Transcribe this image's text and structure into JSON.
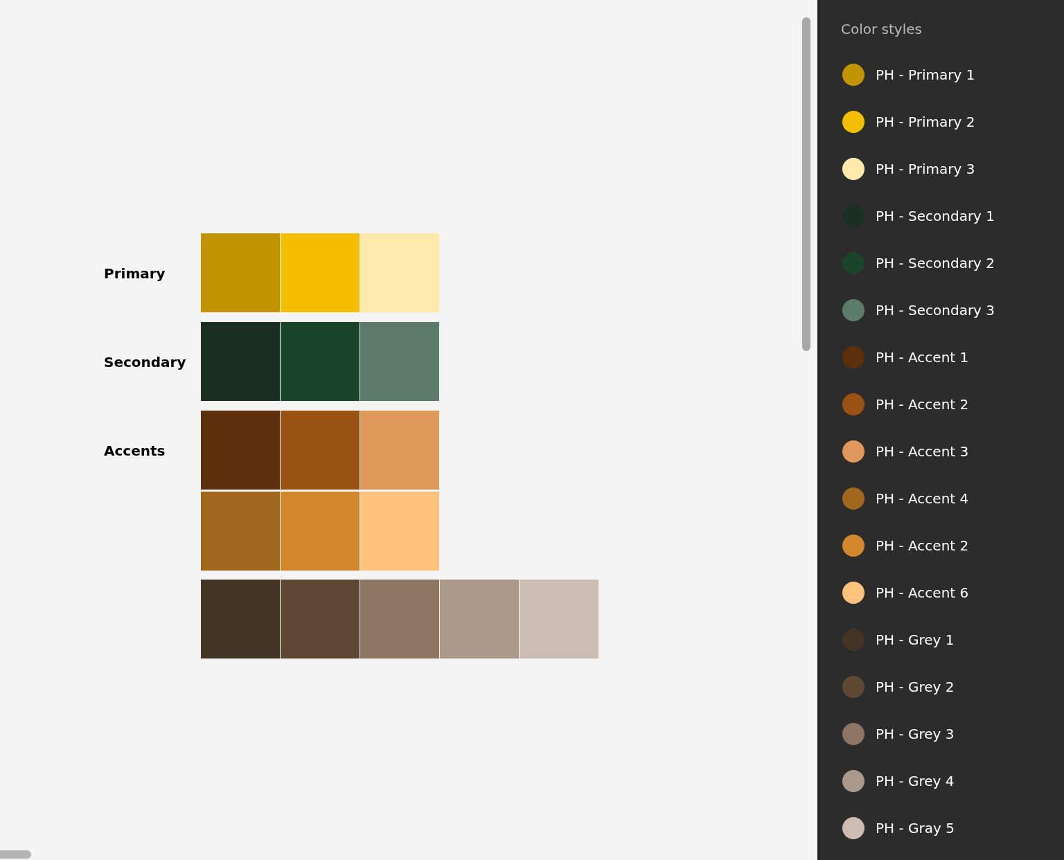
{
  "canvas": {
    "groups": [
      {
        "label": "Primary",
        "rows": [
          [
            {
              "color": "#c29500"
            },
            {
              "color": "#f5bf00"
            },
            {
              "color": "#ffe9ab"
            }
          ]
        ]
      },
      {
        "label": "Secondary",
        "rows": [
          [
            {
              "color": "#1a2f22"
            },
            {
              "color": "#19462b"
            },
            {
              "color": "#5c7b6a"
            }
          ]
        ]
      },
      {
        "label": "Accents",
        "rows": [
          [
            {
              "color": "#5c300a"
            },
            {
              "color": "#9a5213"
            },
            {
              "color": "#df985a"
            }
          ],
          [
            {
              "color": "#a0671e"
            },
            {
              "color": "#d2882a"
            },
            {
              "color": "#ffc37d"
            }
          ]
        ]
      },
      {
        "rows": [
          [
            {
              "color": "#443425"
            },
            {
              "color": "#5f4833"
            },
            {
              "color": "#8c7563"
            },
            {
              "color": "#ad998a"
            },
            {
              "color": "#ccbdb3"
            }
          ]
        ]
      }
    ]
  },
  "sidebar": {
    "title": "Color styles",
    "items": [
      {
        "name": "PH - Primary 1",
        "color": "#c29500"
      },
      {
        "name": "PH - Primary 2",
        "color": "#f5bf00"
      },
      {
        "name": "PH - Primary 3",
        "color": "#ffe9ab"
      },
      {
        "name": "PH - Secondary 1",
        "color": "#1a2f22"
      },
      {
        "name": "PH - Secondary 2",
        "color": "#19462b"
      },
      {
        "name": "PH - Secondary 3",
        "color": "#5c7b6a"
      },
      {
        "name": "PH - Accent 1",
        "color": "#5c300a"
      },
      {
        "name": "PH - Accent 2",
        "color": "#9a5213"
      },
      {
        "name": "PH - Accent 3",
        "color": "#df985a"
      },
      {
        "name": "PH - Accent 4",
        "color": "#a0671e"
      },
      {
        "name": "PH - Accent 2",
        "color": "#d2882a"
      },
      {
        "name": "PH - Accent 6",
        "color": "#ffc37d"
      },
      {
        "name": "PH - Grey 1",
        "color": "#443425"
      },
      {
        "name": "PH - Grey 2",
        "color": "#5f4833"
      },
      {
        "name": "PH - Grey 3",
        "color": "#8c7563"
      },
      {
        "name": "PH - Grey 4",
        "color": "#ad998a"
      },
      {
        "name": "PH - Gray 5",
        "color": "#ccbdb3"
      }
    ]
  }
}
